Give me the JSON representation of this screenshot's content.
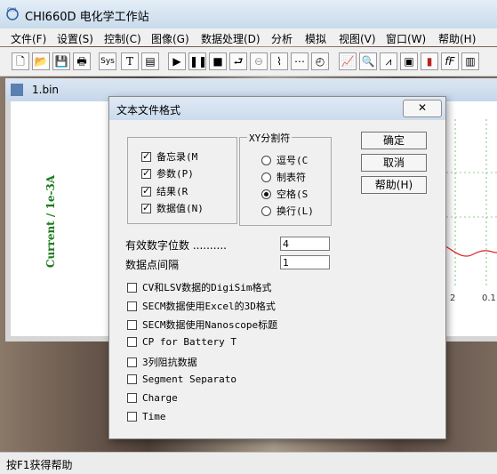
{
  "app": {
    "title": "CHI660D 电化学工作站",
    "icon": "chi-logo-icon"
  },
  "menu": [
    "文件(F)",
    "设置(S)",
    "控制(C)",
    "图像(G)",
    "数据处理(D)",
    "分析",
    "模拟",
    "视图(V)",
    "窗口(W)",
    "帮助(H)"
  ],
  "toolbar": {
    "sys_label": "Sys",
    "text_label": "T",
    "ff_label": "fF",
    "icons": [
      "new-icon",
      "open-icon",
      "save-icon",
      "print-icon",
      "sys-icon",
      "text-icon",
      "page-icon",
      "run-icon",
      "pause-icon",
      "stop-icon",
      "reverse-icon",
      "ir-icon",
      "zoom-icon",
      "graph-icon",
      "analysis-icon",
      "curve-icon",
      "search-icon",
      "peak-icon",
      "print-setup-icon",
      "color-icon",
      "font-icon"
    ]
  },
  "document": {
    "name": "1.bin",
    "ylabel": "Current / 1e-3A",
    "ticks": [
      "2",
      "0.1"
    ]
  },
  "dialog": {
    "title": "文本文件格式",
    "close": "✕",
    "content_group": {
      "items": [
        {
          "label": "备忘录(M",
          "checked": true
        },
        {
          "label": "参数(P)",
          "checked": true
        },
        {
          "label": "结果(R",
          "checked": true
        },
        {
          "label": "数据值(N)",
          "checked": true
        }
      ]
    },
    "separator_group": {
      "title": "XY分割符",
      "options": [
        {
          "label": "逗号(C",
          "selected": false
        },
        {
          "label": "制表符",
          "selected": false
        },
        {
          "label": "空格(S",
          "selected": true
        },
        {
          "label": "换行(L)",
          "selected": false
        }
      ]
    },
    "buttons": {
      "ok": "确定",
      "cancel": "取消",
      "help": "帮助(H)"
    },
    "sig_digits_label": "有效数字位数 ..........",
    "sig_digits_value": "4",
    "interval_label": "数据点间隔",
    "interval_value": "1",
    "options": [
      {
        "label": "CV和LSV数据的DigiSim格式",
        "checked": false
      },
      {
        "label": "SECM数据使用Excel的3D格式",
        "checked": false
      },
      {
        "label": "SECM数据使用Nanoscope标题",
        "checked": false
      },
      {
        "label": "CP for Battery T",
        "checked": false
      },
      {
        "label": "3列阻抗数据",
        "checked": false
      },
      {
        "label": "Segment Separato",
        "checked": false
      },
      {
        "label": "Charge",
        "checked": false
      },
      {
        "label": "Time",
        "checked": false
      }
    ]
  },
  "status": {
    "text": "按F1获得帮助"
  }
}
